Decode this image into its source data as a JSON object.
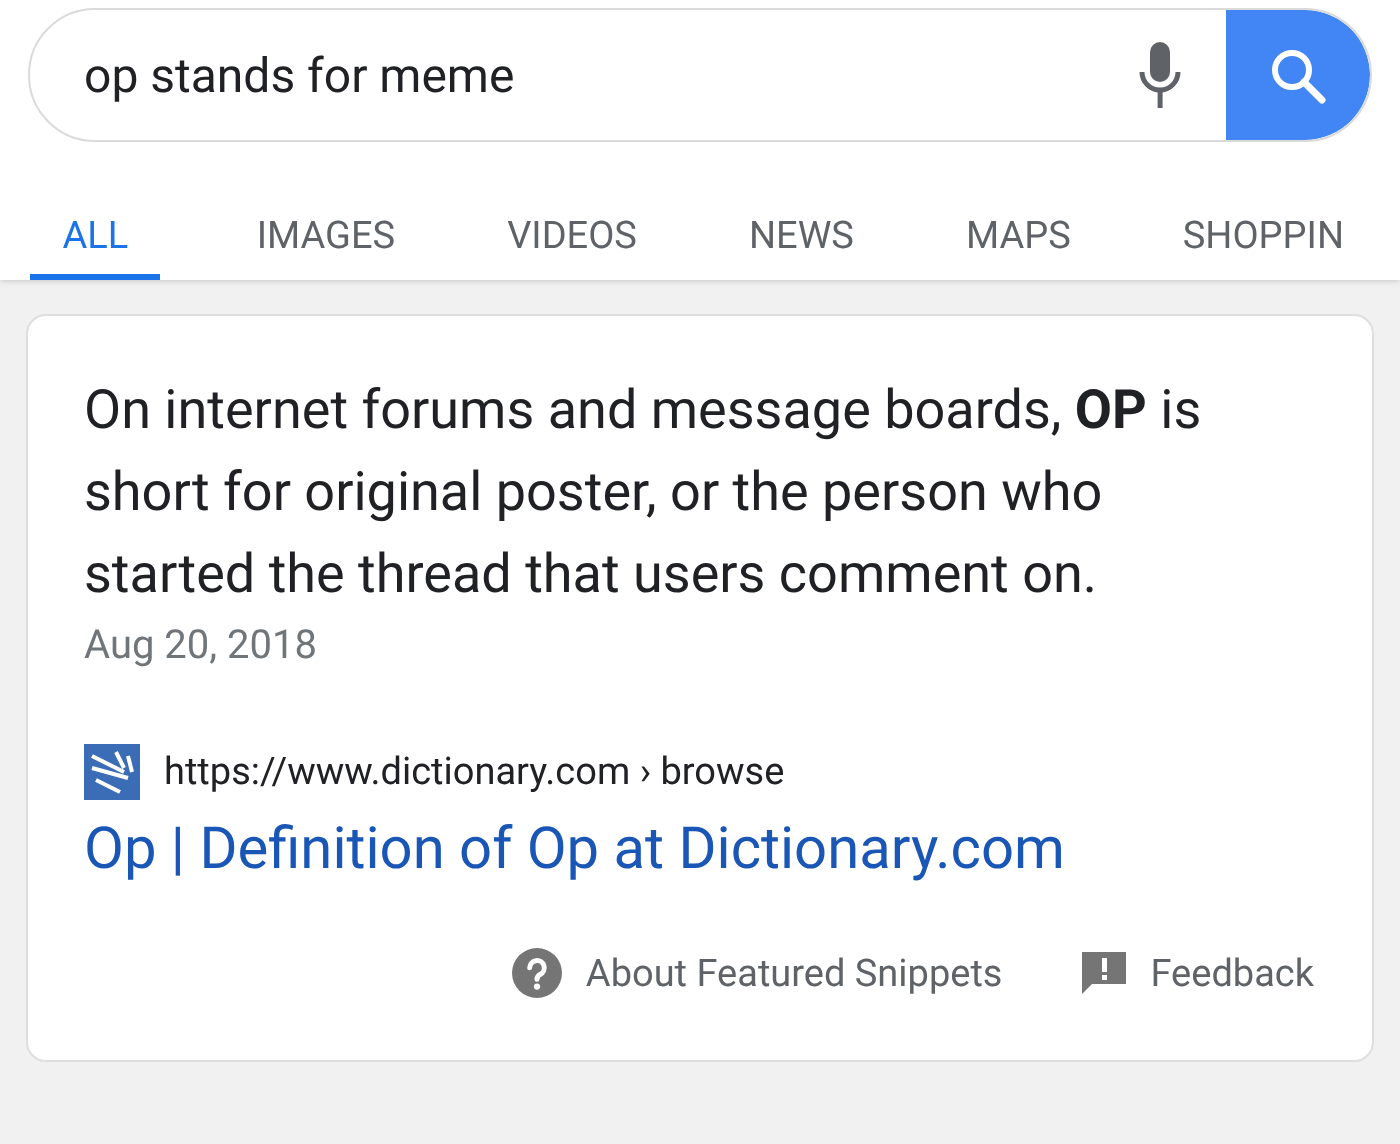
{
  "search": {
    "value": "op stands for meme"
  },
  "tabs": [
    {
      "label": "ALL",
      "selected": true
    },
    {
      "label": "IMAGES",
      "selected": false
    },
    {
      "label": "VIDEOS",
      "selected": false
    },
    {
      "label": "NEWS",
      "selected": false
    },
    {
      "label": "MAPS",
      "selected": false
    },
    {
      "label": "SHOPPIN",
      "selected": false
    }
  ],
  "snippet": {
    "text": "On internet forums and message boards, **OP** is short for original poster, or the person who started the thread that users comment on.",
    "date": "Aug 20, 2018",
    "url": "https://www.dictionary.com › browse",
    "title": "Op | Definition of Op at Dictionary.com",
    "about": "About Featured Snippets",
    "feedback": "Feedback"
  }
}
